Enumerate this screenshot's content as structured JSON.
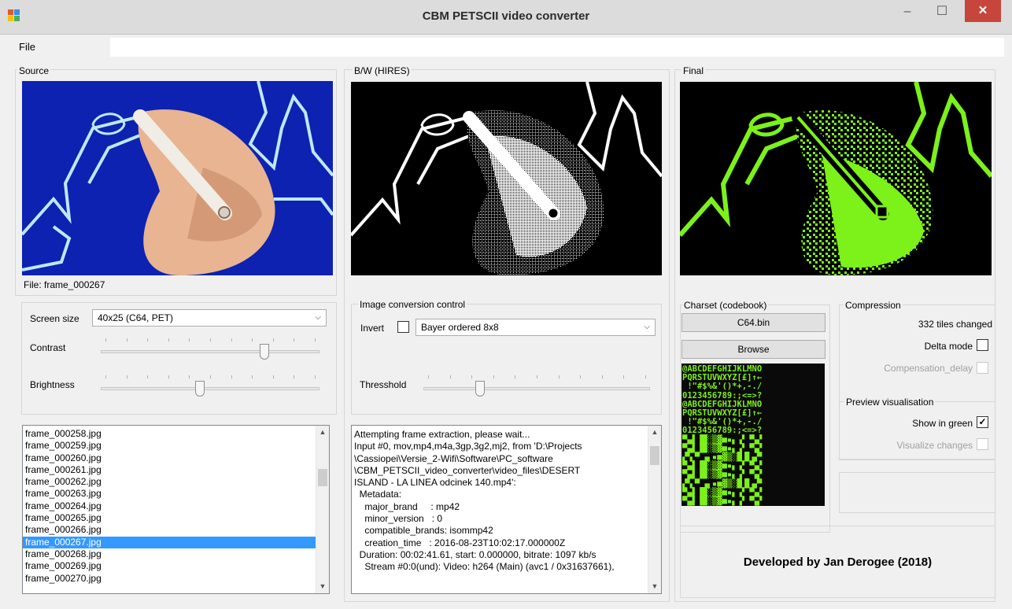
{
  "window": {
    "title": "CBM PETSCII video converter",
    "minimize": "–",
    "maximize": "☐",
    "close": "✕"
  },
  "menu": {
    "file": "File"
  },
  "source": {
    "label": "Source",
    "file_label": "File: frame_000267"
  },
  "bw": {
    "label": "B/W (HIRES)"
  },
  "final": {
    "label": "Final"
  },
  "settings": {
    "screen_size_label": "Screen size",
    "screen_size_value": "40x25 (C64, PET)",
    "contrast_label": "Contrast",
    "contrast_level": 0.76,
    "brightness_label": "Brightness",
    "brightness_level": 0.45
  },
  "conversion": {
    "group_label": "Image conversion control",
    "invert_label": "Invert",
    "invert_checked": false,
    "dither_value": "Bayer ordered 8x8",
    "threshold_label": "Thresshold",
    "threshold_level": 0.24
  },
  "charset": {
    "group_label": "Charset (codebook)",
    "file_button": "C64.bin",
    "browse_button": "Browse"
  },
  "compression": {
    "group_label": "Compression",
    "tiles_changed": "332 tiles changed",
    "delta_mode_label": "Delta mode",
    "delta_mode_checked": false,
    "compensation_label": "Compensation_delay",
    "compensation_checked": false
  },
  "preview": {
    "group_label": "Preview visualisation",
    "show_green_label": "Show in green",
    "show_green_checked": true,
    "visualize_label": "Visualize changes",
    "visualize_checked": false
  },
  "frames": {
    "items": [
      "frame_000258.jpg",
      "frame_000259.jpg",
      "frame_000260.jpg",
      "frame_000261.jpg",
      "frame_000262.jpg",
      "frame_000263.jpg",
      "frame_000264.jpg",
      "frame_000265.jpg",
      "frame_000266.jpg",
      "frame_000267.jpg",
      "frame_000268.jpg",
      "frame_000269.jpg",
      "frame_000270.jpg"
    ],
    "selected_index": 9
  },
  "log": {
    "lines": [
      "Attempting frame extraction, please wait...",
      "Input #0, mov,mp4,m4a,3gp,3g2,mj2, from 'D:\\Projects",
      "\\Cassiopei\\Versie_2-Wifi\\Software\\PC_software",
      "\\CBM_PETSCII_video_converter\\video_files\\DESERT",
      "ISLAND - LA LINEA odcinek 140.mp4':",
      "  Metadata:",
      "    major_brand     : mp42",
      "    minor_version   : 0",
      "    compatible_brands: isommp42",
      "    creation_time   : 2016-08-23T10:02:17.000000Z",
      "  Duration: 00:02:41.61, start: 0.000000, bitrate: 1097 kb/s",
      "    Stream #0:0(und): Video: h264 (Main) (avc1 / 0x31637661),"
    ]
  },
  "credits": {
    "text": "Developed by Jan Derogee (2018)"
  },
  "colors": {
    "source_bg": "#0a1fa8",
    "final_green": "#7cf11a",
    "selection": "#3399ff",
    "close_red": "#c7463c"
  },
  "charset_preview": {
    "rows": [
      "@ABCDEFGHIJKLMNO",
      "PQRSTUVWXYZ[£]↑←",
      " !\"#$%&'()*+,-./",
      "0123456789:;<=>?",
      "@ABCDEFGHIJKLMNO",
      "PQRSTUVWXYZ[£]↑←",
      " !\"#$%&'()*+,-./",
      "0123456789:;<=>?"
    ]
  }
}
